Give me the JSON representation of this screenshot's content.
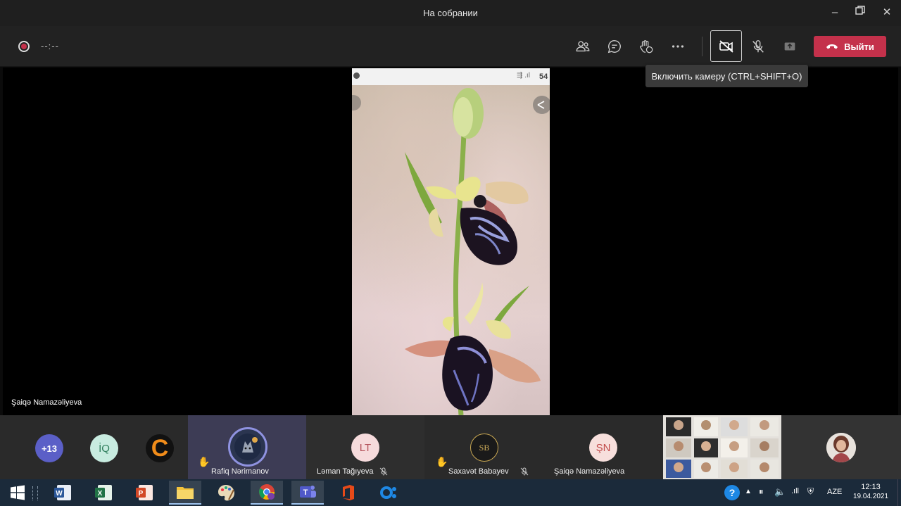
{
  "window": {
    "title": "На собрании"
  },
  "controls": {
    "timer": "--:--",
    "leave_label": "Выйти",
    "tooltip": "Включить камеру (CTRL+SHIFT+O)"
  },
  "stage": {
    "speaker_name": "Şaiqə Namazəliyeva",
    "status_percent": "54"
  },
  "participants": {
    "overflow": "+13",
    "iq_initials": "İQ",
    "c_initial": "C",
    "rafiq": {
      "name": "Rafiq Nərimanov"
    },
    "laman": {
      "initials": "LT",
      "name": "Ləman Tağıyeva"
    },
    "saxavat": {
      "initials": "SB",
      "name": "Saxavət Babayev"
    },
    "saiqe": {
      "initials": "ŞN",
      "name": "Şaiqə Namazəliyeva"
    }
  },
  "taskbar": {
    "lang": "AZE",
    "time": "12:13",
    "date": "19.04.2021"
  },
  "colors": {
    "leave": "#c4314b",
    "accent": "#6264a7"
  }
}
